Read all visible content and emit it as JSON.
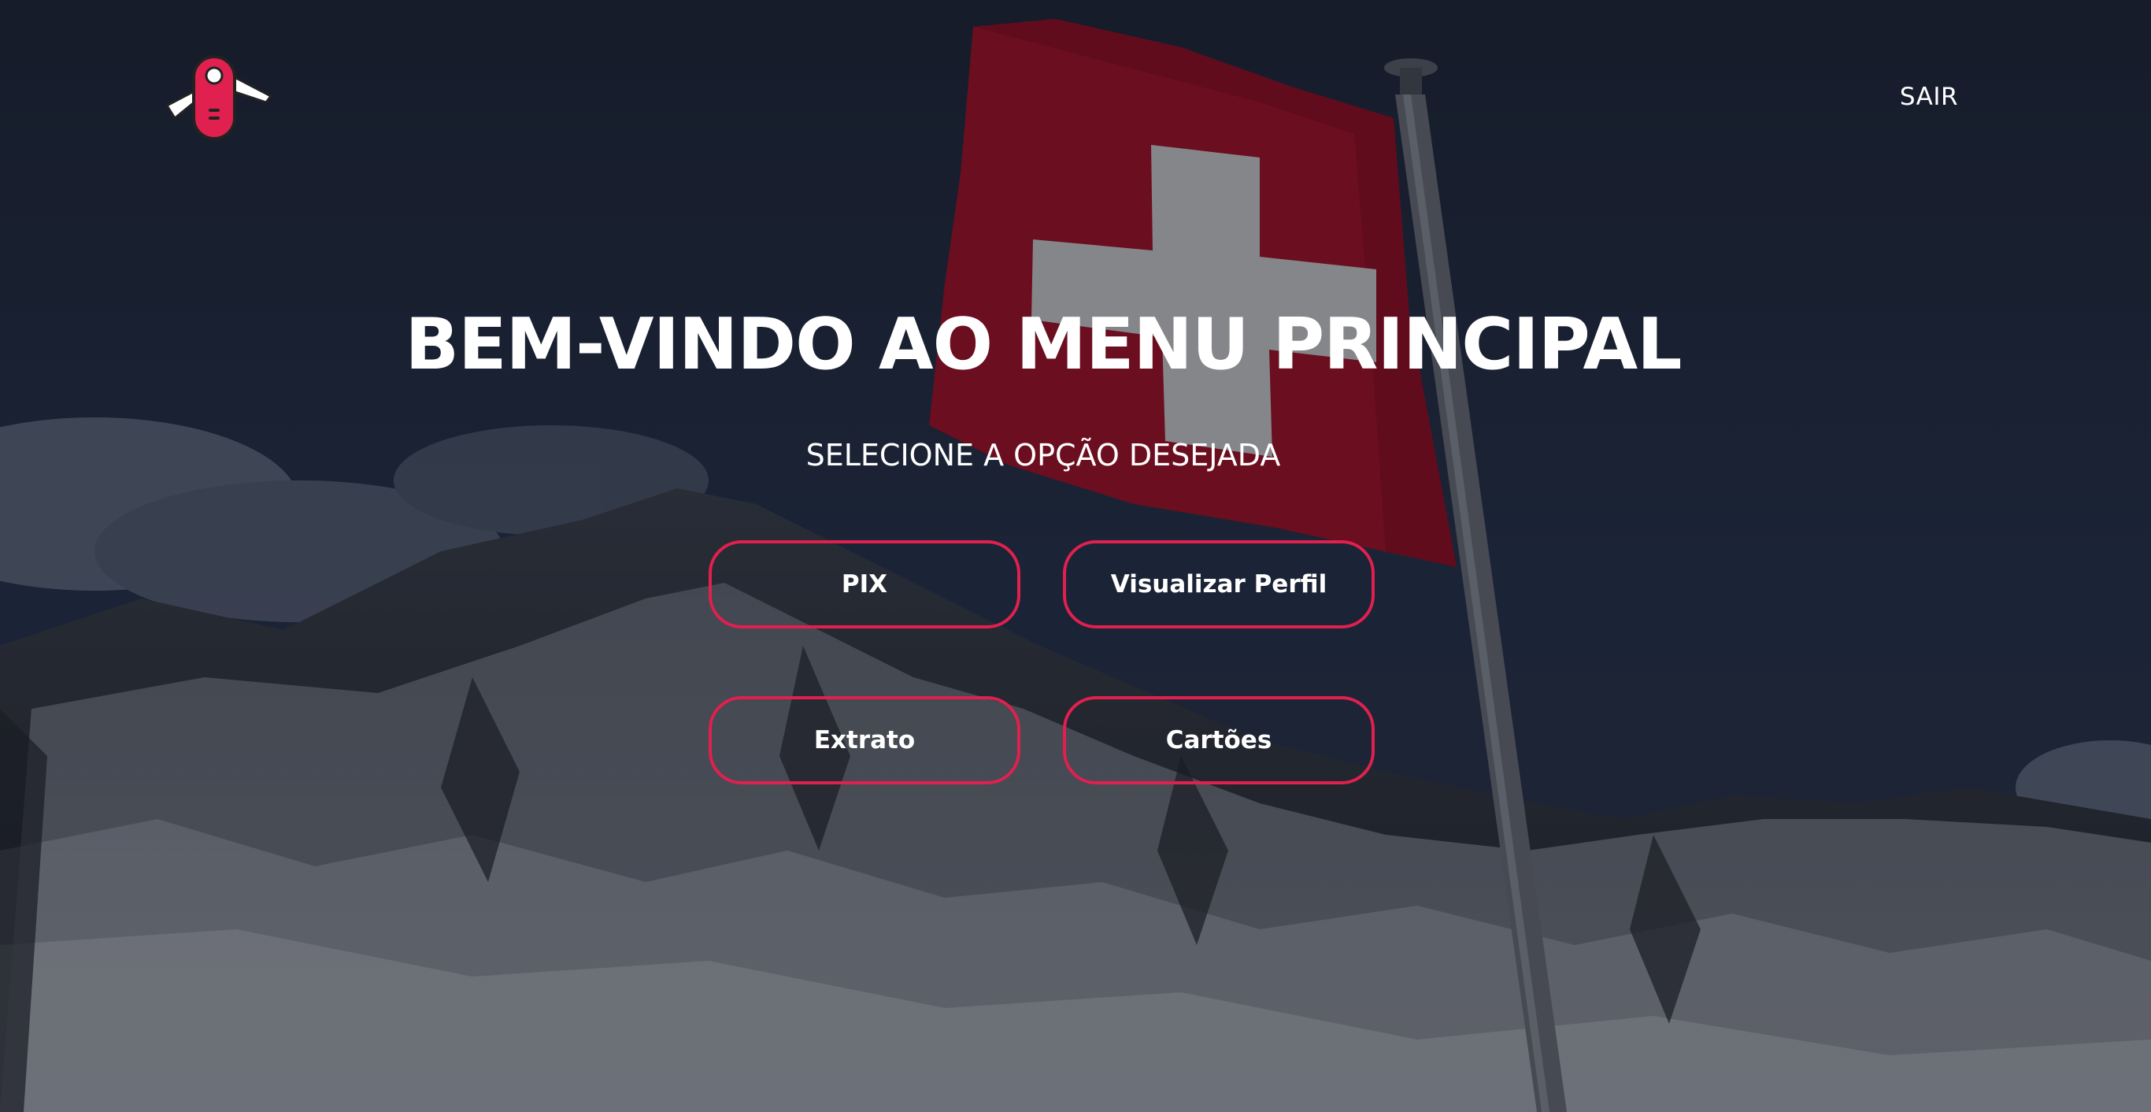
{
  "header": {
    "logout_label": "SAIR"
  },
  "hero": {
    "title": "BEM-VINDO AO MENU PRINCIPAL",
    "subtitle": "SELECIONE A OPÇÃO DESEJADA"
  },
  "options": [
    {
      "label": "PIX"
    },
    {
      "label": "Visualizar Perfil"
    },
    {
      "label": "Extrato"
    },
    {
      "label": "Cartões"
    }
  ],
  "colors": {
    "accent": "#e0204e",
    "text": "#ffffff",
    "flag_red": "#c8102e"
  },
  "icons": {
    "logo": "swiss-army-knife-icon"
  }
}
